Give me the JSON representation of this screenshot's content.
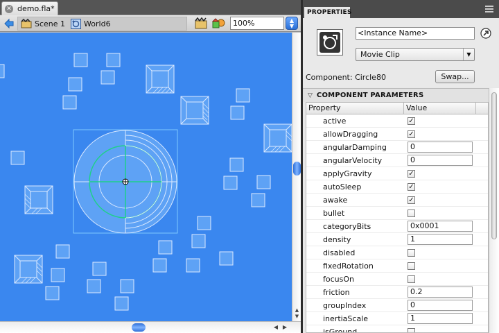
{
  "document": {
    "tab_title": "demo.fla*",
    "breadcrumb": [
      {
        "label": "Scene 1",
        "icon": "scene-icon"
      },
      {
        "label": "World6",
        "icon": "movieclip-icon"
      }
    ],
    "zoom": "100%"
  },
  "stage": {
    "background": "#3a87ef",
    "shape_fill": "#5ea2f5",
    "shape_stroke": "#dceaff",
    "selection_color": "#7fc8ff",
    "accent_ring": "#1fd08a"
  },
  "properties": {
    "tab_label": "PROPERTIES",
    "instance_name_placeholder": "<Instance Name>",
    "symbol_type": "Movie Clip",
    "component_label": "Component:  Circle80",
    "swap_label": "Swap...",
    "section_title": "COMPONENT PARAMETERS",
    "col_property": "Property",
    "col_value": "Value",
    "rows": [
      {
        "name": "active",
        "type": "checkbox",
        "checked": true
      },
      {
        "name": "allowDragging",
        "type": "checkbox",
        "checked": true
      },
      {
        "name": "angularDamping",
        "type": "text",
        "value": "0"
      },
      {
        "name": "angularVelocity",
        "type": "text",
        "value": "0"
      },
      {
        "name": "applyGravity",
        "type": "checkbox",
        "checked": true
      },
      {
        "name": "autoSleep",
        "type": "checkbox",
        "checked": true
      },
      {
        "name": "awake",
        "type": "checkbox",
        "checked": true
      },
      {
        "name": "bullet",
        "type": "checkbox",
        "checked": false
      },
      {
        "name": "categoryBits",
        "type": "text",
        "value": "0x0001"
      },
      {
        "name": "density",
        "type": "text",
        "value": "1"
      },
      {
        "name": "disabled",
        "type": "checkbox",
        "checked": false
      },
      {
        "name": "fixedRotation",
        "type": "checkbox",
        "checked": false
      },
      {
        "name": "focusOn",
        "type": "checkbox",
        "checked": false
      },
      {
        "name": "friction",
        "type": "text",
        "value": "0.2"
      },
      {
        "name": "groupIndex",
        "type": "text",
        "value": "0"
      },
      {
        "name": "inertiaScale",
        "type": "text",
        "value": "1"
      },
      {
        "name": "isGround",
        "type": "checkbox",
        "checked": false
      }
    ]
  }
}
